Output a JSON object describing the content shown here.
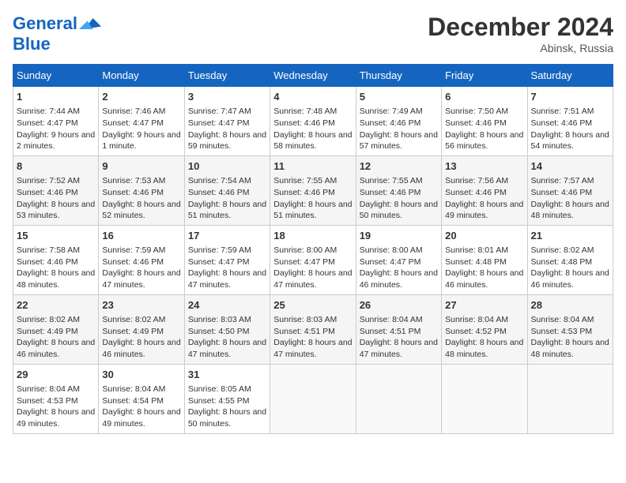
{
  "header": {
    "logo_line1": "General",
    "logo_line2": "Blue",
    "month": "December 2024",
    "location": "Abinsk, Russia"
  },
  "days_of_week": [
    "Sunday",
    "Monday",
    "Tuesday",
    "Wednesday",
    "Thursday",
    "Friday",
    "Saturday"
  ],
  "weeks": [
    [
      {
        "day": "1",
        "info": "Sunrise: 7:44 AM\nSunset: 4:47 PM\nDaylight: 9 hours\nand 2 minutes."
      },
      {
        "day": "2",
        "info": "Sunrise: 7:46 AM\nSunset: 4:47 PM\nDaylight: 9 hours\nand 1 minute."
      },
      {
        "day": "3",
        "info": "Sunrise: 7:47 AM\nSunset: 4:47 PM\nDaylight: 8 hours\nand 59 minutes."
      },
      {
        "day": "4",
        "info": "Sunrise: 7:48 AM\nSunset: 4:46 PM\nDaylight: 8 hours\nand 58 minutes."
      },
      {
        "day": "5",
        "info": "Sunrise: 7:49 AM\nSunset: 4:46 PM\nDaylight: 8 hours\nand 57 minutes."
      },
      {
        "day": "6",
        "info": "Sunrise: 7:50 AM\nSunset: 4:46 PM\nDaylight: 8 hours\nand 56 minutes."
      },
      {
        "day": "7",
        "info": "Sunrise: 7:51 AM\nSunset: 4:46 PM\nDaylight: 8 hours\nand 54 minutes."
      }
    ],
    [
      {
        "day": "8",
        "info": "Sunrise: 7:52 AM\nSunset: 4:46 PM\nDaylight: 8 hours\nand 53 minutes."
      },
      {
        "day": "9",
        "info": "Sunrise: 7:53 AM\nSunset: 4:46 PM\nDaylight: 8 hours\nand 52 minutes."
      },
      {
        "day": "10",
        "info": "Sunrise: 7:54 AM\nSunset: 4:46 PM\nDaylight: 8 hours\nand 51 minutes."
      },
      {
        "day": "11",
        "info": "Sunrise: 7:55 AM\nSunset: 4:46 PM\nDaylight: 8 hours\nand 51 minutes."
      },
      {
        "day": "12",
        "info": "Sunrise: 7:55 AM\nSunset: 4:46 PM\nDaylight: 8 hours\nand 50 minutes."
      },
      {
        "day": "13",
        "info": "Sunrise: 7:56 AM\nSunset: 4:46 PM\nDaylight: 8 hours\nand 49 minutes."
      },
      {
        "day": "14",
        "info": "Sunrise: 7:57 AM\nSunset: 4:46 PM\nDaylight: 8 hours\nand 48 minutes."
      }
    ],
    [
      {
        "day": "15",
        "info": "Sunrise: 7:58 AM\nSunset: 4:46 PM\nDaylight: 8 hours\nand 48 minutes."
      },
      {
        "day": "16",
        "info": "Sunrise: 7:59 AM\nSunset: 4:46 PM\nDaylight: 8 hours\nand 47 minutes."
      },
      {
        "day": "17",
        "info": "Sunrise: 7:59 AM\nSunset: 4:47 PM\nDaylight: 8 hours\nand 47 minutes."
      },
      {
        "day": "18",
        "info": "Sunrise: 8:00 AM\nSunset: 4:47 PM\nDaylight: 8 hours\nand 47 minutes."
      },
      {
        "day": "19",
        "info": "Sunrise: 8:00 AM\nSunset: 4:47 PM\nDaylight: 8 hours\nand 46 minutes."
      },
      {
        "day": "20",
        "info": "Sunrise: 8:01 AM\nSunset: 4:48 PM\nDaylight: 8 hours\nand 46 minutes."
      },
      {
        "day": "21",
        "info": "Sunrise: 8:02 AM\nSunset: 4:48 PM\nDaylight: 8 hours\nand 46 minutes."
      }
    ],
    [
      {
        "day": "22",
        "info": "Sunrise: 8:02 AM\nSunset: 4:49 PM\nDaylight: 8 hours\nand 46 minutes."
      },
      {
        "day": "23",
        "info": "Sunrise: 8:02 AM\nSunset: 4:49 PM\nDaylight: 8 hours\nand 46 minutes."
      },
      {
        "day": "24",
        "info": "Sunrise: 8:03 AM\nSunset: 4:50 PM\nDaylight: 8 hours\nand 47 minutes."
      },
      {
        "day": "25",
        "info": "Sunrise: 8:03 AM\nSunset: 4:51 PM\nDaylight: 8 hours\nand 47 minutes."
      },
      {
        "day": "26",
        "info": "Sunrise: 8:04 AM\nSunset: 4:51 PM\nDaylight: 8 hours\nand 47 minutes."
      },
      {
        "day": "27",
        "info": "Sunrise: 8:04 AM\nSunset: 4:52 PM\nDaylight: 8 hours\nand 48 minutes."
      },
      {
        "day": "28",
        "info": "Sunrise: 8:04 AM\nSunset: 4:53 PM\nDaylight: 8 hours\nand 48 minutes."
      }
    ],
    [
      {
        "day": "29",
        "info": "Sunrise: 8:04 AM\nSunset: 4:53 PM\nDaylight: 8 hours\nand 49 minutes."
      },
      {
        "day": "30",
        "info": "Sunrise: 8:04 AM\nSunset: 4:54 PM\nDaylight: 8 hours\nand 49 minutes."
      },
      {
        "day": "31",
        "info": "Sunrise: 8:05 AM\nSunset: 4:55 PM\nDaylight: 8 hours\nand 50 minutes."
      },
      {
        "day": "",
        "info": ""
      },
      {
        "day": "",
        "info": ""
      },
      {
        "day": "",
        "info": ""
      },
      {
        "day": "",
        "info": ""
      }
    ]
  ]
}
